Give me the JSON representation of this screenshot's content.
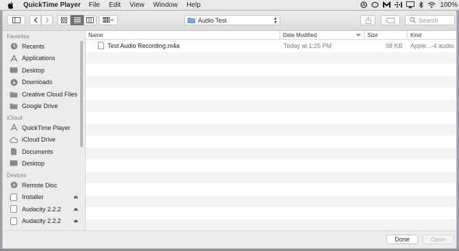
{
  "menubar": {
    "app_name": "QuickTime Player",
    "items": [
      "File",
      "Edit",
      "View",
      "Window",
      "Help"
    ],
    "battery_text": "100%"
  },
  "toolbar": {
    "location": "Audio Test",
    "search_placeholder": "Search"
  },
  "sidebar": {
    "sections": [
      {
        "title": "Favorites",
        "items": [
          {
            "label": "Recents",
            "icon": "clock-icon"
          },
          {
            "label": "Applications",
            "icon": "applications-icon"
          },
          {
            "label": "Desktop",
            "icon": "desktop-icon"
          },
          {
            "label": "Downloads",
            "icon": "download-icon"
          },
          {
            "label": "Creative Cloud Files",
            "icon": "folder-icon"
          },
          {
            "label": "Google Drive",
            "icon": "folder-icon"
          }
        ]
      },
      {
        "title": "iCloud",
        "items": [
          {
            "label": "QuickTime Player",
            "icon": "applications-icon"
          },
          {
            "label": "iCloud Drive",
            "icon": "cloud-icon"
          },
          {
            "label": "Documents",
            "icon": "document-icon"
          },
          {
            "label": "Desktop",
            "icon": "desktop-icon"
          }
        ]
      },
      {
        "title": "Devices",
        "items": [
          {
            "label": "Remote Disc",
            "icon": "disc-icon"
          },
          {
            "label": "Installer",
            "icon": "drive-icon",
            "eject": true
          },
          {
            "label": "Audacity 2.2.2",
            "icon": "drive-icon",
            "eject": true
          },
          {
            "label": "Audacity 2.2.2",
            "icon": "drive-icon",
            "eject": true
          }
        ]
      }
    ]
  },
  "filelist": {
    "columns": {
      "name": "Name",
      "date": "Date Modified",
      "size": "Size",
      "kind": "Kind"
    },
    "files": [
      {
        "name": "Test Audio Recording.m4a",
        "date": "Today at 1:25 PM",
        "size": "98 KB",
        "kind": "Apple...-4 audio"
      }
    ]
  },
  "buttons": {
    "done": "Done",
    "open": "Open"
  }
}
